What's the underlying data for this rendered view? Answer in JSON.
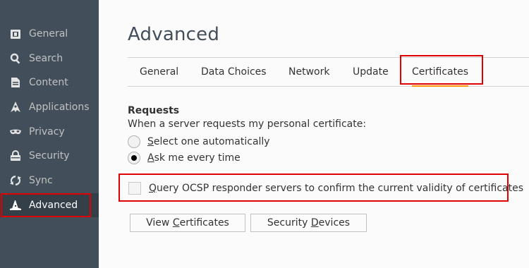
{
  "sidebar": {
    "items": [
      {
        "label": "General",
        "icon": "general-icon"
      },
      {
        "label": "Search",
        "icon": "search-icon"
      },
      {
        "label": "Content",
        "icon": "content-icon"
      },
      {
        "label": "Applications",
        "icon": "applications-icon"
      },
      {
        "label": "Privacy",
        "icon": "privacy-mask-icon"
      },
      {
        "label": "Security",
        "icon": "lock-icon"
      },
      {
        "label": "Sync",
        "icon": "sync-icon"
      },
      {
        "label": "Advanced",
        "icon": "advanced-wizard-hat-icon",
        "selected": true
      }
    ]
  },
  "main": {
    "title": "Advanced",
    "tabs": [
      {
        "label": "General"
      },
      {
        "label": "Data Choices"
      },
      {
        "label": "Network"
      },
      {
        "label": "Update"
      },
      {
        "label": "Certificates",
        "selected": true
      }
    ],
    "requests": {
      "title": "Requests",
      "description": "When a server requests my personal certificate:",
      "options": [
        {
          "accesskey": "S",
          "rest": "elect one automatically",
          "checked": false
        },
        {
          "accesskey": "A",
          "rest": "sk me every time",
          "checked": true
        }
      ]
    },
    "ocsp": {
      "accesskey": "Q",
      "rest": "uery OCSP responder servers to confirm the current validity of certificates",
      "checked": false
    },
    "buttons": {
      "view_certificates": {
        "pre": "View ",
        "accesskey": "C",
        "post": "ertificates"
      },
      "security_devices": {
        "pre": "Security ",
        "accesskey": "D",
        "post": "evices"
      }
    }
  },
  "colors": {
    "sidebar_bg": "#424f5a",
    "selected_item_bg": "#343f48",
    "highlight_outline": "#e00000",
    "tab_underline": "#ff9500"
  }
}
